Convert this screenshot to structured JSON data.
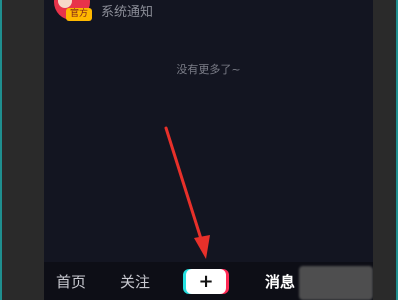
{
  "notification": {
    "badge": "官方",
    "title": "系统通知"
  },
  "empty_state": "没有更多了~",
  "tabbar": {
    "home": "首页",
    "follow": "关注",
    "create": "+",
    "messages": "消息"
  },
  "colors": {
    "background": "#131521",
    "tabbar": "#0d0e16",
    "accent_red": "#e8334a",
    "arrow": "#e8302a",
    "cyan": "#26e0e0",
    "pink": "#ff2a55"
  },
  "icons": {
    "avatar": "official-avatar-icon",
    "create": "plus-icon",
    "annotation": "red-arrow-icon"
  }
}
